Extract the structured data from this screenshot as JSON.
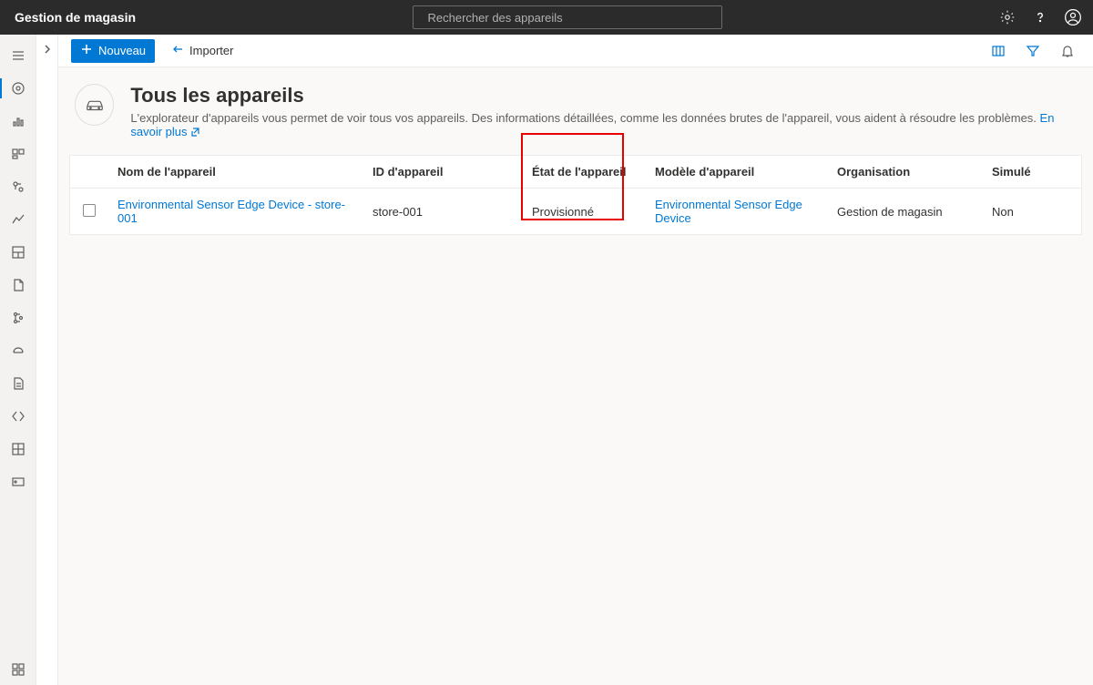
{
  "topbar": {
    "title": "Gestion de magasin",
    "search_placeholder": "Rechercher des appareils"
  },
  "cmdbar": {
    "new_label": "Nouveau",
    "import_label": "Importer"
  },
  "header": {
    "title": "Tous les appareils",
    "subtitle_pre": "L'explorateur d'appareils vous permet de voir tous vos appareils. Des informations détaillées, comme les données brutes de l'appareil, vous aident à résoudre les problèmes. ",
    "learn_more": "En savoir plus"
  },
  "table": {
    "columns": {
      "name": "Nom de l'appareil",
      "id": "ID d'appareil",
      "state": "État de l'appareil",
      "model": "Modèle d'appareil",
      "org": "Organisation",
      "sim": "Simulé"
    },
    "rows": [
      {
        "name": "Environmental Sensor Edge Device - store-001",
        "id": "store-001",
        "state": "Provisionné",
        "model": "Environmental Sensor Edge Device",
        "org": "Gestion de magasin",
        "sim": "Non"
      }
    ]
  }
}
